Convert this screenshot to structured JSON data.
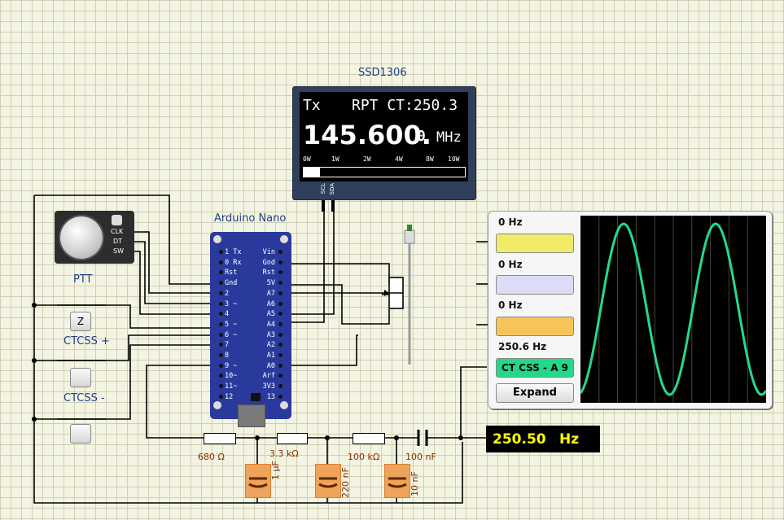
{
  "oled": {
    "title": "SSD1306",
    "mode": "Tx",
    "status": "RPT CT:250.3",
    "freq_main": "145.600.",
    "freq_small": "0",
    "freq_unit": "MHz",
    "power_scale": [
      "0W",
      "1W",
      "2W",
      "4W",
      "8W",
      "10W"
    ],
    "pin_scl": "SCL",
    "pin_sda": "SDA",
    "power_level": 0.1
  },
  "encoder": {
    "pins": [
      "CLK",
      "DT",
      "SW"
    ]
  },
  "nano": {
    "title": "Arduino Nano",
    "left_pins": [
      "1 Tx",
      "0 Rx",
      "Rst",
      "Gnd",
      "2",
      "3 ~",
      "4",
      "5 ~",
      "6 ~",
      "7",
      "8",
      "9 ~",
      "10~",
      "11~",
      "12"
    ],
    "right_pins": [
      "Vin",
      "Gnd",
      "Rst",
      "5V",
      "A7",
      "A6",
      "A5",
      "A4",
      "A3",
      "A2",
      "A1",
      "A0",
      "Arf",
      "3V3",
      "13"
    ]
  },
  "buttons": {
    "ptt_label": "PTT",
    "ptt_key": "Z",
    "ctcss_plus_label": "CTCSS +",
    "ctcss_minus_label": "CTCSS -"
  },
  "scope": {
    "channels": [
      {
        "freq": "0 Hz",
        "color": "#f0ec6a"
      },
      {
        "freq": "0 Hz",
        "color": "#dcdcf6"
      },
      {
        "freq": "0 Hz",
        "color": "#f7c45a"
      },
      {
        "freq": "250.6 Hz",
        "color": "#22d98a",
        "name": "CT CSS - A 9"
      }
    ],
    "expand_label": "Expand",
    "trace_color": "#25d98d"
  },
  "filter": {
    "resistors": [
      "680 Ω",
      "3.3 kΩ",
      "100 kΩ"
    ],
    "capacitor_series": "100 nF",
    "capacitors_shunt": [
      "1 µF",
      "220 nF",
      "10 nF"
    ]
  },
  "frequency_meter": {
    "value": "250.50",
    "unit": "Hz"
  }
}
